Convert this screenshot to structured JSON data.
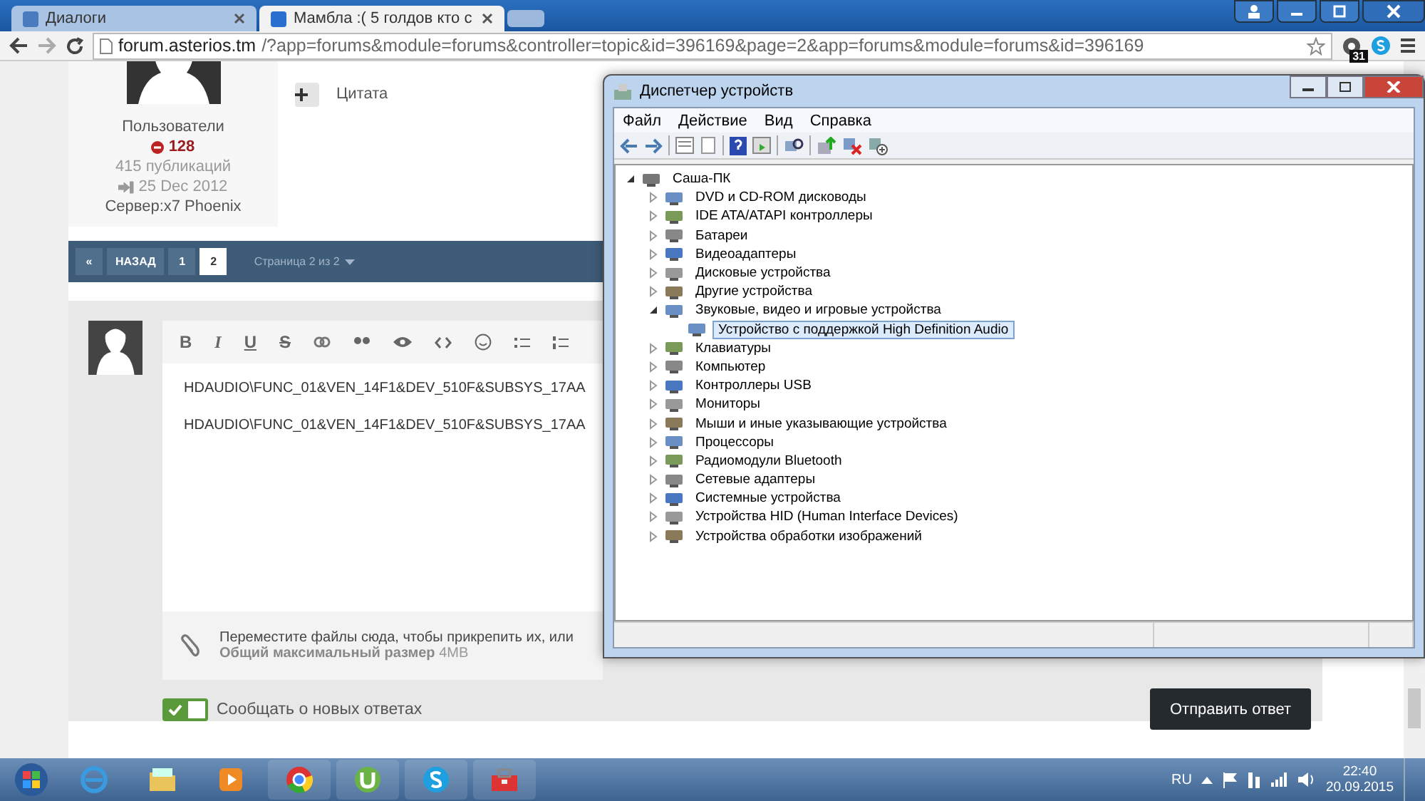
{
  "browser": {
    "tabs": [
      {
        "title": "Диалоги",
        "selected": false
      },
      {
        "title": "Мамбла :( 5 голдов кто с",
        "selected": true
      }
    ],
    "url_host": "forum.asterios.tm",
    "url_rest": "/?app=forums&module=forums&controller=topic&id=396169&page=2&app=forums&module=forums&id=396169",
    "extension_badge": "31"
  },
  "post": {
    "author": {
      "group": "Пользователи",
      "reputation": "128",
      "posts": "415 публикаций",
      "joined": "25 Dec 2012",
      "server": "Сервер:x7 Phoenix"
    },
    "quote_label": "Цитата"
  },
  "pagination": {
    "first": "«",
    "prev": "НАЗАД",
    "pages": [
      {
        "label": "1",
        "selected": false
      },
      {
        "label": "2",
        "selected": true
      }
    ],
    "summary": "Страница 2 из 2"
  },
  "reply": {
    "format_buttons": [
      "B",
      "I",
      "U",
      "S"
    ],
    "lines": [
      "HDAUDIO\\FUNC_01&VEN_14F1&DEV_510F&SUBSYS_17AA",
      "HDAUDIO\\FUNC_01&VEN_14F1&DEV_510F&SUBSYS_17AA"
    ],
    "attach_hint": "Переместите файлы сюда, чтобы прикрепить их, или",
    "attach_limit": "**Общий максимальный размер** 4MB",
    "notify": {
      "label": "Сообщать о новых ответах",
      "checked": true
    },
    "submit": "Отправить ответ"
  },
  "device_manager": {
    "title": "Диспетчер устройств",
    "menu": [
      "Файл",
      "Действие",
      "Вид",
      "Справка"
    ],
    "tree": [
      {
        "label": "Саша-ПК",
        "expanded": true,
        "selected": false,
        "children": [
          {
            "label": "DVD и CD-ROM дисководы",
            "expanded": false,
            "selected": false
          },
          {
            "label": "IDE ATA/ATAPI контроллеры",
            "expanded": false,
            "selected": false
          },
          {
            "label": "Батареи",
            "expanded": false,
            "selected": false
          },
          {
            "label": "Видеоадаптеры",
            "expanded": false,
            "selected": false
          },
          {
            "label": "Дисковые устройства",
            "expanded": false,
            "selected": false
          },
          {
            "label": "Другие устройства",
            "expanded": false,
            "selected": false
          },
          {
            "label": "Звуковые, видео и игровые устройства",
            "expanded": true,
            "selected": false,
            "children": [
              {
                "label": "Устройство с поддержкой High Definition Audio",
                "selected": true
              }
            ]
          },
          {
            "label": "Клавиатуры",
            "expanded": false,
            "selected": false
          },
          {
            "label": "Компьютер",
            "expanded": false,
            "selected": false
          },
          {
            "label": "Контроллеры USB",
            "expanded": false,
            "selected": false
          },
          {
            "label": "Мониторы",
            "expanded": false,
            "selected": false
          },
          {
            "label": "Мыши и иные указывающие устройства",
            "expanded": false,
            "selected": false
          },
          {
            "label": "Процессоры",
            "expanded": false,
            "selected": false
          },
          {
            "label": "Радиомодули Bluetooth",
            "expanded": false,
            "selected": false
          },
          {
            "label": "Сетевые адаптеры",
            "expanded": false,
            "selected": false
          },
          {
            "label": "Системные устройства",
            "expanded": false,
            "selected": false
          },
          {
            "label": "Устройства HID (Human Interface Devices)",
            "expanded": false,
            "selected": false
          },
          {
            "label": "Устройства обработки изображений",
            "expanded": false,
            "selected": false
          }
        ]
      }
    ]
  },
  "taskbar": {
    "language": "RU",
    "time": "22:40",
    "date": "20.09.2015"
  }
}
